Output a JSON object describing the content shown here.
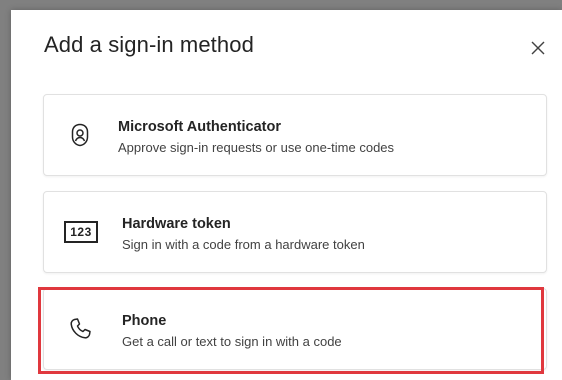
{
  "dialog": {
    "title": "Add a sign-in method",
    "close_icon": "close-icon"
  },
  "methods": [
    {
      "title": "Microsoft Authenticator",
      "description": "Approve sign-in requests or use one-time codes",
      "icon": "authenticator-lock-icon"
    },
    {
      "title": "Hardware token",
      "description": "Sign in with a code from a hardware token",
      "icon": "hardware-token-icon",
      "icon_text": "123"
    },
    {
      "title": "Phone",
      "description": "Get a call or text to sign in with a code",
      "icon": "phone-icon",
      "highlighted": true
    }
  ],
  "colors": {
    "highlight": "#e0383e",
    "text_primary": "#242424",
    "text_secondary": "#424242",
    "card_border": "#e1e1e1",
    "backdrop": "#808080"
  }
}
